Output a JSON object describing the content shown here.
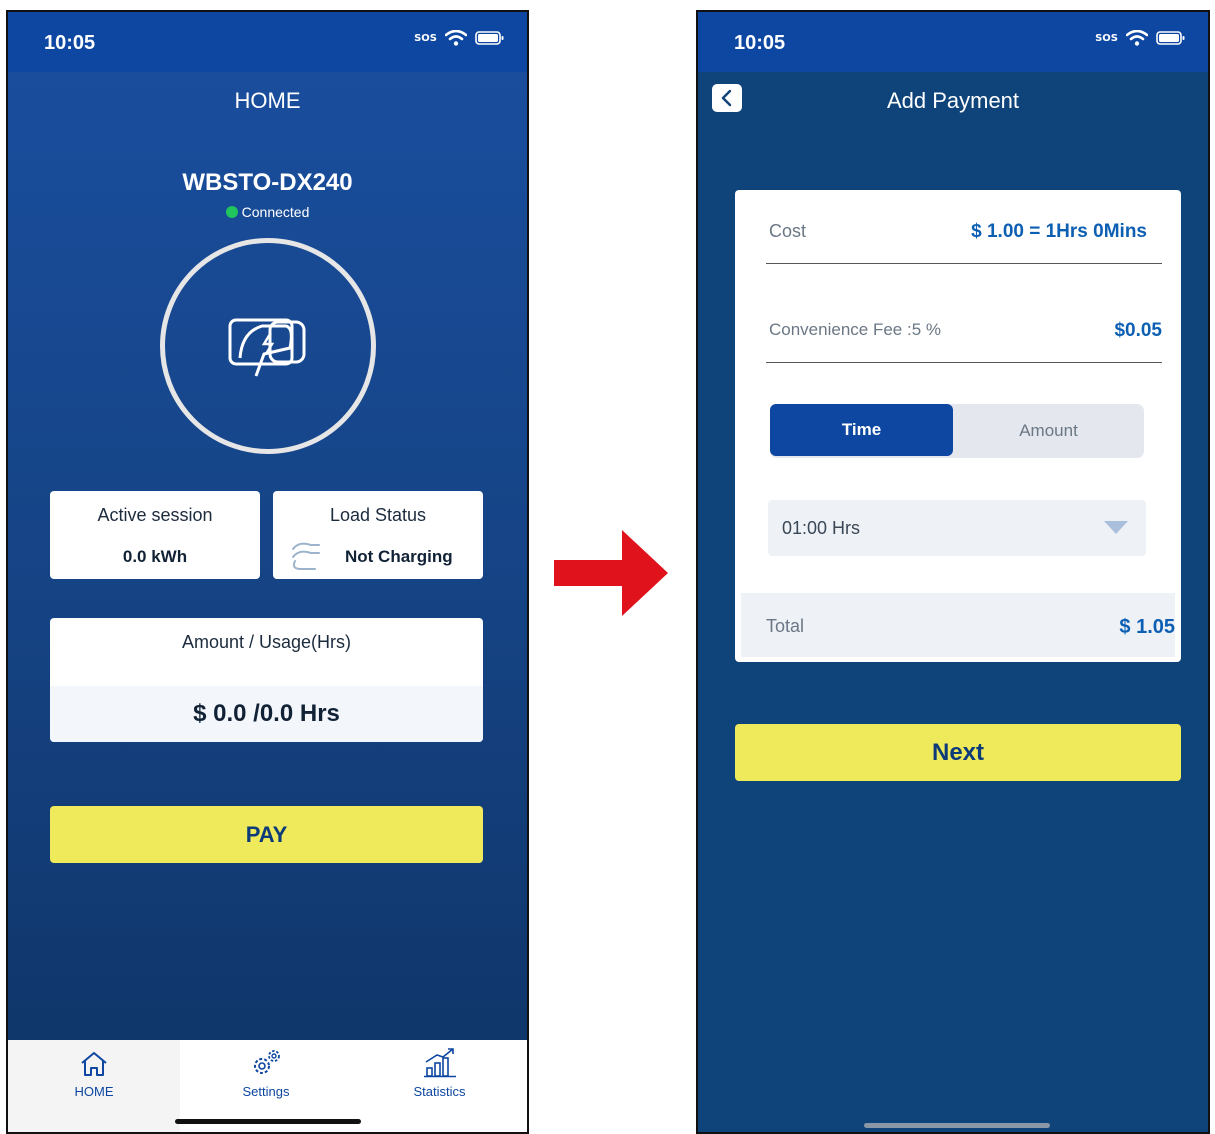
{
  "left_screen": {
    "status": {
      "time": "10:05",
      "sos": "SOS"
    },
    "header_title": "HOME",
    "device_name": "WBSTO-DX240",
    "connection_status": "Connected",
    "active_session": {
      "label": "Active session",
      "value": "0.0 kWh"
    },
    "load_status": {
      "label": "Load Status",
      "value": "Not Charging"
    },
    "amount_usage": {
      "label": "Amount / Usage(Hrs)",
      "value": "$ 0.0 /0.0 Hrs"
    },
    "pay_button": "PAY",
    "nav": [
      {
        "label": "HOME",
        "icon": "home-icon"
      },
      {
        "label": "Settings",
        "icon": "settings-gear-icon"
      },
      {
        "label": "Statistics",
        "icon": "statistics-chart-icon"
      }
    ],
    "colors": {
      "primary": "#0d47a1",
      "accent_yellow": "#efe95c",
      "connected_green": "#21c55d"
    }
  },
  "right_screen": {
    "status": {
      "time": "10:05",
      "sos": "SOS"
    },
    "header_title": "Add Payment",
    "cost": {
      "label": "Cost",
      "value": "$ 1.00 = 1Hrs 0Mins"
    },
    "convenience_fee": {
      "label": "Convenience Fee :5 %",
      "value": "$0.05"
    },
    "toggle": {
      "selected": "Time",
      "options": [
        "Time",
        "Amount"
      ]
    },
    "duration_select": "01:00 Hrs",
    "total": {
      "label": "Total",
      "value": "$ 1.05"
    },
    "next_button": "Next"
  }
}
